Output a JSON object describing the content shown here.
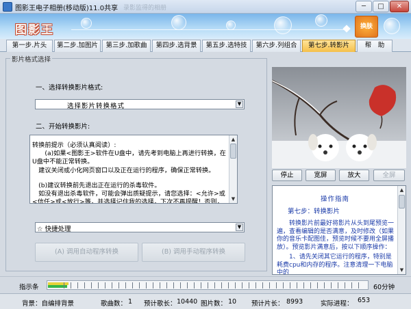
{
  "window": {
    "title": "图影王电子相册(移动版)11.0共享",
    "ghost_title": "录影监得的相册",
    "min_label": "─",
    "max_label": "□",
    "close_label": "✕"
  },
  "banner": {
    "logo": "图影王",
    "render_badge": "换肤"
  },
  "tabs": [
    {
      "label": "第一步.片头",
      "active": false
    },
    {
      "label": "第二步.加图片",
      "active": false
    },
    {
      "label": "第三步.加歌曲",
      "active": false
    },
    {
      "label": "第四步.选背景",
      "active": false
    },
    {
      "label": "第五步.选特技",
      "active": false
    },
    {
      "label": "第六步.列组合",
      "active": false
    },
    {
      "label": "第七步.转影片",
      "active": true
    },
    {
      "label": "帮　助",
      "active": false
    }
  ],
  "left": {
    "group_title": "影片格式选择",
    "section1": "一、选择转换影片格式:",
    "format_combo": "选择影片转换格式",
    "section2": "二、开始转换影片:",
    "memo_lines": [
      "转换前提示（必须认真阅读）:",
      "　　(a)如果<图影王>软件在U盘中，请先考到电脑上再进行转换，在U盘中不能正常转换。",
      "　建议关闭或小化网页窗口以及正在运行的程序，确保正常转换。",
      "　(b)建议转换前先退出正在运行的杀毒软件。",
      "　如没有退出杀毒软件，可能会弹出质疑提示，请您选择：<允许>或<信任>或<放行>等，并选择记住我的选择，下次不再提醒！否则，转换可能会失败。"
    ],
    "quick_combo": "☆ 快捷处理",
    "auto_btn": "(A) 调用自动程序转换",
    "manual_btn": "(B) 调用手动程序转换"
  },
  "right": {
    "stop": "停止",
    "wide": "宽屏",
    "zoom": "放大",
    "fullscreen": "全屏",
    "guide_title": "操作指南",
    "guide_step": "第七步：转换影片",
    "guide_paragraphs": [
      "　　转换影片前最好将影片从头到尾预览一遍，查看编辑的是否满意，及时修改（如果你的音乐卡配图佳，预览时候不要用全屏播放）。预览影片满意后，按以下顺序操作：",
      "　　1、请先关闭其它运行的程序，特别是耗费cpu和内存的程序。注意清理一下电脑中的"
    ]
  },
  "indicator": {
    "label": "指示条",
    "end_label": "60分钟",
    "progress_fraction": 0.06
  },
  "status": {
    "background_label": "背景：自编排背景",
    "song_count_label": "歌曲数：",
    "song_count": "1",
    "est_song_len_label": "预计歌长：",
    "est_song_len": "10440",
    "pic_count_label": "图片数：",
    "pic_count": "10",
    "est_film_len_label": "预计片长：",
    "est_film_len": "8993",
    "actual_progress_label": "实际进程：",
    "actual_progress": "653"
  },
  "colors": {
    "accent_tab": "#f5c04a",
    "guide_text": "#1a3aa8",
    "indicator_fill": "#35b54a"
  }
}
